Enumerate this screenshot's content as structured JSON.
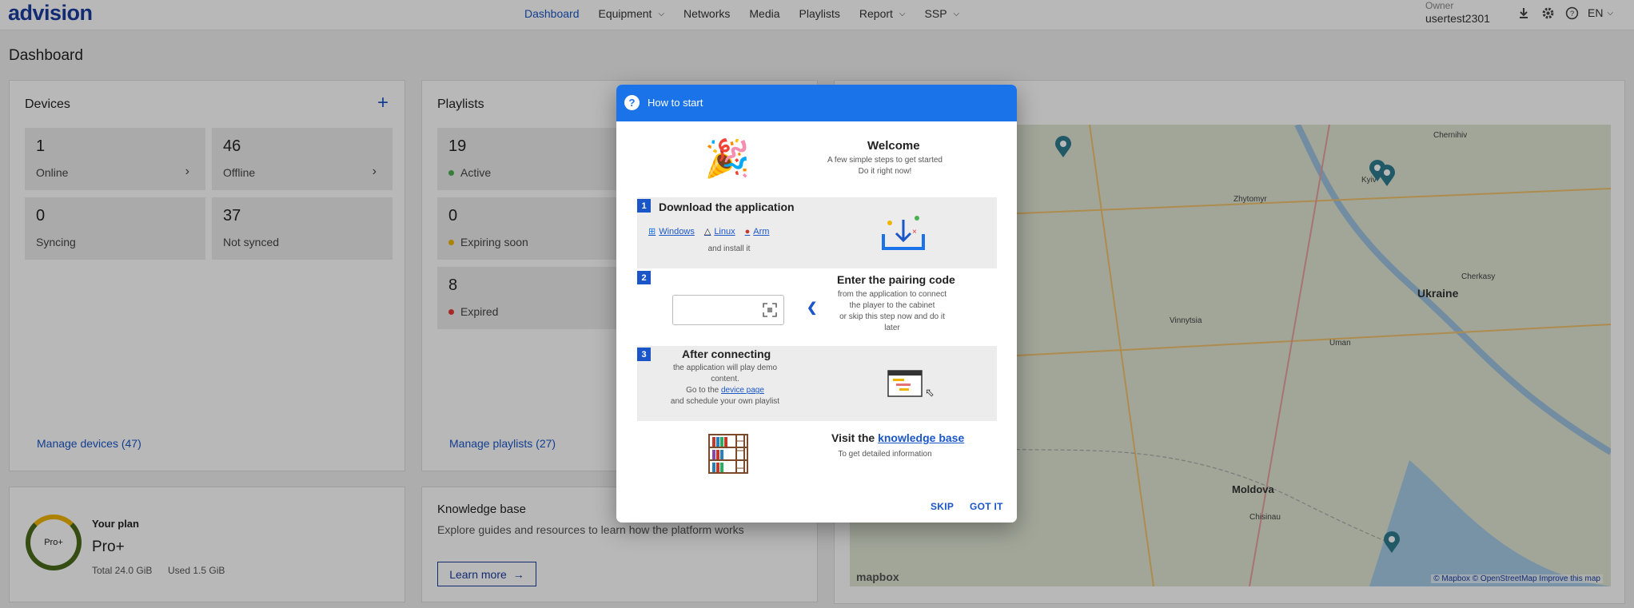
{
  "header": {
    "logo": "advision",
    "nav": [
      {
        "label": "Dashboard",
        "active": true,
        "dropdown": false
      },
      {
        "label": "Equipment",
        "active": false,
        "dropdown": true
      },
      {
        "label": "Networks",
        "active": false,
        "dropdown": false
      },
      {
        "label": "Media",
        "active": false,
        "dropdown": false
      },
      {
        "label": "Playlists",
        "active": false,
        "dropdown": false
      },
      {
        "label": "Report",
        "active": false,
        "dropdown": true
      },
      {
        "label": "SSP",
        "active": false,
        "dropdown": true
      }
    ],
    "owner_label": "Owner",
    "owner_name": "usertest2301",
    "language": "EN"
  },
  "page_title": "Dashboard",
  "devices": {
    "title": "Devices",
    "online": {
      "value": "1",
      "label": "Online"
    },
    "offline": {
      "value": "46",
      "label": "Offline"
    },
    "syncing": {
      "value": "0",
      "label": "Syncing"
    },
    "not_synced": {
      "value": "37",
      "label": "Not synced"
    },
    "manage_link": "Manage devices (47)"
  },
  "playlists": {
    "title": "Playlists",
    "active": {
      "value": "19",
      "label": "Active"
    },
    "expiring": {
      "value": "0",
      "label": "Expiring soon"
    },
    "expired": {
      "value": "8",
      "label": "Expired"
    },
    "manage_link": "Manage playlists (27)"
  },
  "plan": {
    "ring_label": "Pro+",
    "title": "Your plan",
    "name": "Pro+",
    "total": "Total 24.0 GiB",
    "used": "Used 1.5 GiB",
    "used_fraction": 0.0625
  },
  "knowledge": {
    "title": "Knowledge base",
    "desc": "Explore guides and resources to learn how the platform works",
    "button": "Learn more"
  },
  "map": {
    "labels": [
      "Ukraine",
      "Moldova",
      "Kyiv",
      "Chernihiv",
      "Zhytomyr",
      "Vinnytsia",
      "Cherkasy",
      "Uman",
      "Chisinau"
    ],
    "credit": "© Mapbox © OpenStreetMap  Improve this map",
    "logo": "mapbox"
  },
  "colors": {
    "accent": "#1a56c8",
    "modal_header": "#1a73e8",
    "green": "#4caf50",
    "amber": "#f0b400",
    "red": "#e53935"
  },
  "modal": {
    "title": "How to start",
    "welcome_title": "Welcome",
    "welcome_sub1": "A few simple steps to get started",
    "welcome_sub2": "Do it right now!",
    "step1": {
      "num": "1",
      "title": "Download the application",
      "windows": "Windows",
      "linux": "Linux",
      "arm": "Arm",
      "install": "and install it"
    },
    "step2": {
      "num": "2",
      "title": "Enter the pairing code",
      "line1": "from the application to connect",
      "line2": "the player to the cabinet",
      "line3": "or skip this step now and do it",
      "line4": "later"
    },
    "step3": {
      "num": "3",
      "title": "After connecting",
      "line1": "the application will play demo",
      "line2": "content.",
      "line3_pre": "Go to the",
      "line3_link": "device page",
      "line4": "and schedule your own playlist"
    },
    "kb": {
      "pre": "Visit the",
      "link": "knowledge base",
      "sub": "To get detailed information"
    },
    "skip": "SKIP",
    "gotit": "GOT IT"
  }
}
